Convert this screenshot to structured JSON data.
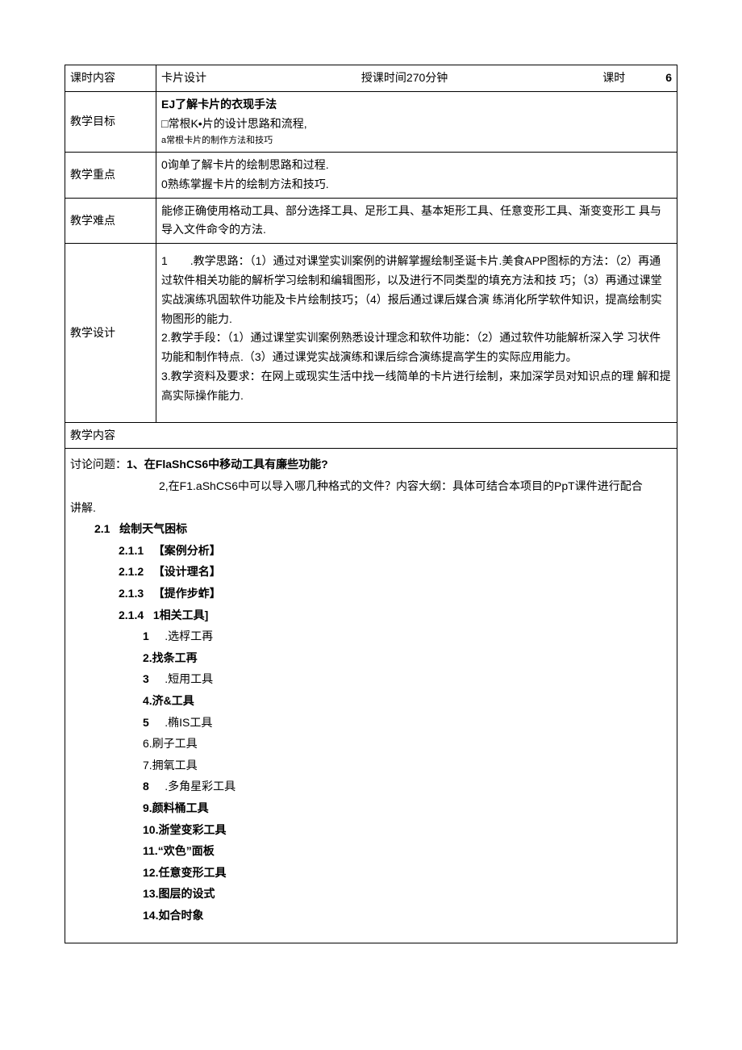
{
  "header": {
    "row1_label": "课时内容",
    "row1_v1": "卡片设计",
    "row1_v2": "授课时间270分钟",
    "row1_v3": "课时",
    "row1_v4": "6",
    "goals_label": "教学目标",
    "goals_line1": "EJ了解卡片的衣现手法",
    "goals_line2": "□常根K•片的设计思路和流程,",
    "goals_line3": "a常根卡片的制作方法和技巧",
    "focus_label": "教学重点",
    "focus_line1": "0询单了解卡片的绘制思路和过程.",
    "focus_line2": "0熟练掌握卡片的绘制方法和技巧.",
    "diff_label": "教学难点",
    "diff_text": "能修正确使用格动工具、部分选择工具、足形工具、基本矩形工具、任意变形工具、渐变变形工 具与导入文件命令的方法.",
    "design_label": "教学设计",
    "design_text": "1　　.教学思路：（1）通过对课堂实训案例的讲解掌握绘制圣诞卡片.美食APP图标的方法：（2）再通过软件相关功能的解析学习绘制和编辑图形，以及进行不同类型的填充方法和技 巧；（3）再通过课堂实战演练巩固软件功能及卡片绘制技巧；（4）报后通过课后媒合演 练消化所学软件知识，提高绘制实物图形的能力.\n2.教学手段：（1）通过课堂实训案例熟悉设计理念和软件功能：（2）通过软件功能解析深入学 习状件功能和制作特点.（3）通过课党实战演练和课后综合演练提高学生的实际应用能力。\n3.教学资料及要求：在网上或现实生活中找一线简单的卡片进行绘制，来加深学员对知识点的理 解和提高实际操作能力."
  },
  "content": {
    "title": "教学内容",
    "discuss_prefix": "讨论问题：",
    "discuss_q1": "1、在FlaShCS6中移动工具有廉些功能?",
    "discuss_q2": "2,在F1.aShCS6中可以导入哪几种格式的文件？内容大纲：具体可结合本项目的PpT课件进行配合",
    "discuss_tail": "讲解.",
    "s21": "2.1",
    "s21_t": "绘制天气困标",
    "s211": "2.1.1",
    "s211_t": "【案例分析】",
    "s212": "2.1.2",
    "s212_t": "【设计理名】",
    "s213": "2.1.3",
    "s213_t": "【提作步蚱】",
    "s214": "2.1.4",
    "s214_t": "1相关工具]",
    "tools": {
      "t1n": "1",
      "t1": ".选桴工再",
      "t2": "2.找条工再",
      "t3n": "3",
      "t3": ".短用工具",
      "t4": "4.济&工具",
      "t5n": "5",
      "t5": ".椭IS工具",
      "t6": "6.刷子工具",
      "t7": "7.拥氧工具",
      "t8n": "8",
      "t8": ".多角星彩工具",
      "t9": "9.颜料桶工具",
      "t10": "10.浙堂变彩工具",
      "t11": "11.“欢色”面板",
      "t12": "12.任意变形工具",
      "t13": "13.图层的设式",
      "t14": "14.如合时象"
    }
  }
}
